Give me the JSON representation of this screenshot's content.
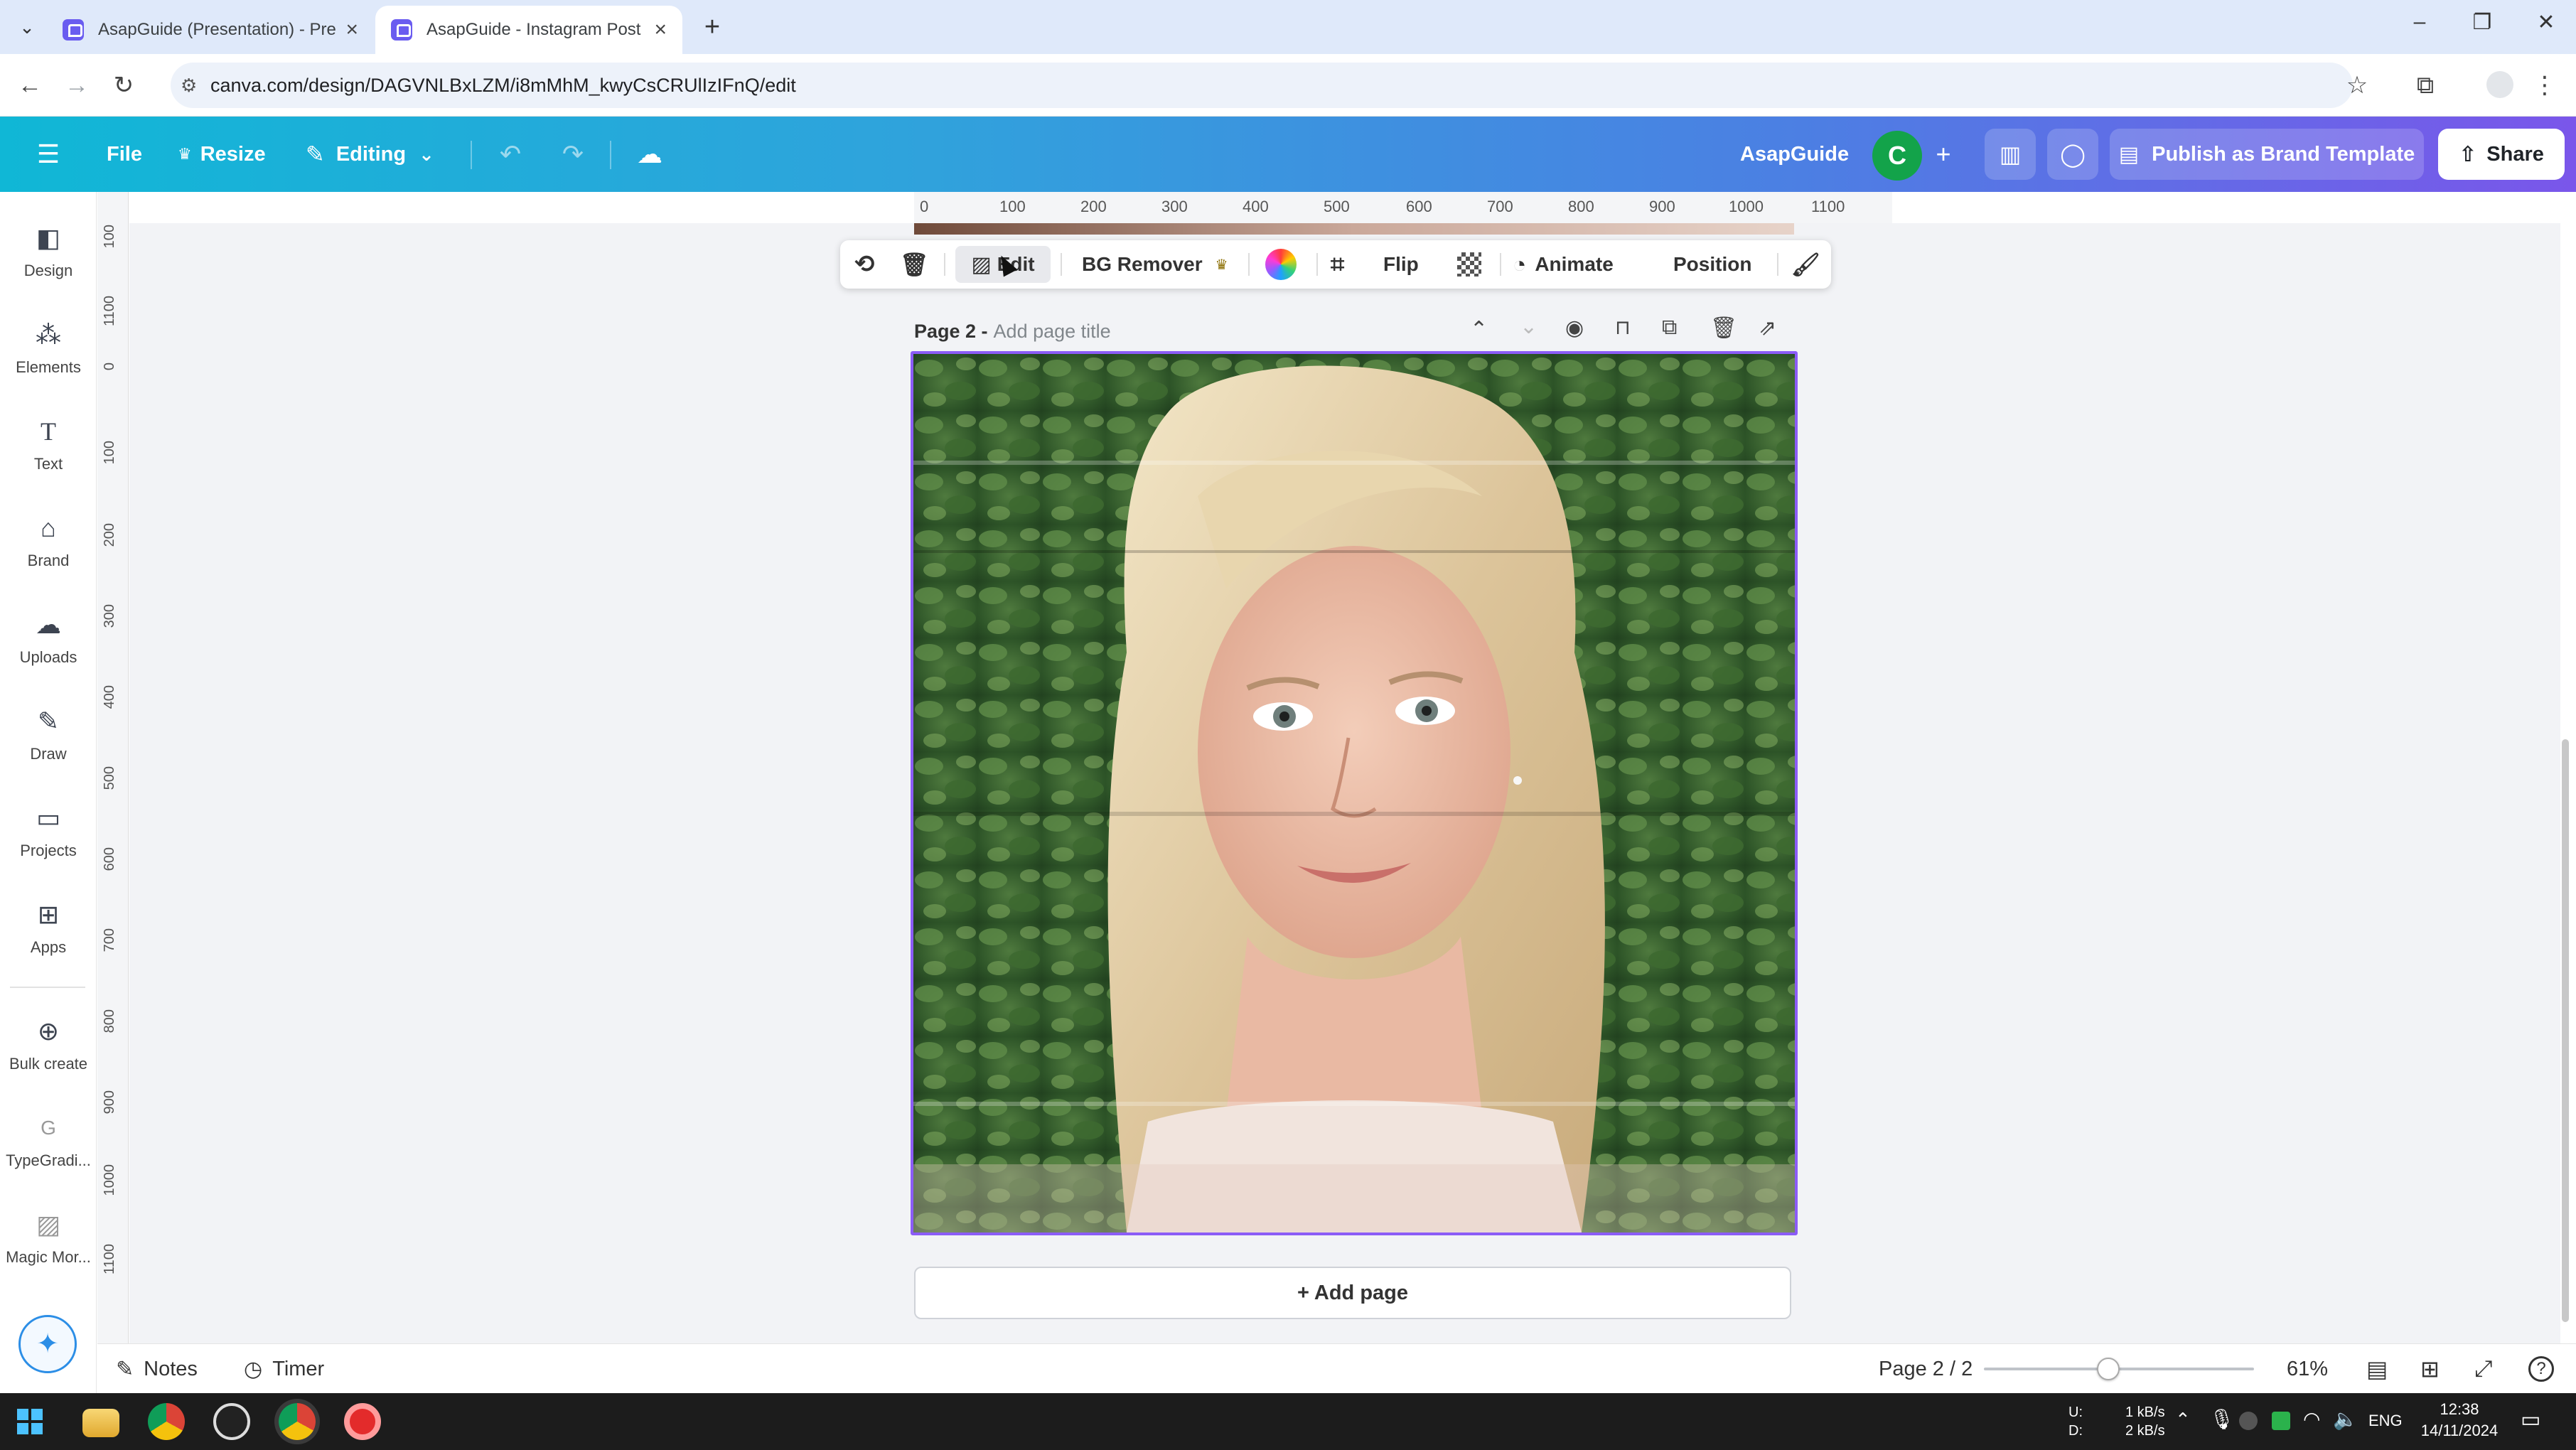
{
  "browser": {
    "tabs": [
      {
        "title": "AsapGuide (Presentation) - Pre",
        "active": false
      },
      {
        "title": "AsapGuide - Instagram Post",
        "active": true
      }
    ],
    "url": "canva.com/design/DAGVNLBxLZM/i8mMhM_kwyCsCRUlIzIFnQ/edit"
  },
  "header": {
    "file_label": "File",
    "resize_label": "Resize",
    "editing_label": "Editing",
    "workspace_name": "AsapGuide",
    "avatar_initial": "C",
    "publish_label": "Publish as Brand Template",
    "share_label": "Share"
  },
  "sidebar": {
    "items": [
      {
        "label": "Design",
        "icon": "layout-icon"
      },
      {
        "label": "Elements",
        "icon": "elements-icon"
      },
      {
        "label": "Text",
        "icon": "text-icon"
      },
      {
        "label": "Brand",
        "icon": "brand-icon"
      },
      {
        "label": "Uploads",
        "icon": "cloud-upload-icon"
      },
      {
        "label": "Draw",
        "icon": "pen-icon"
      },
      {
        "label": "Projects",
        "icon": "folder-icon"
      },
      {
        "label": "Apps",
        "icon": "apps-icon"
      },
      {
        "label": "Bulk create",
        "icon": "bulk-create-icon"
      },
      {
        "label": "TypeGradi...",
        "icon": "typegradient-icon"
      },
      {
        "label": "Magic Mor...",
        "icon": "magic-morph-icon"
      }
    ]
  },
  "rulers": {
    "horizontal": [
      "0",
      "100",
      "200",
      "300",
      "400",
      "500",
      "600",
      "700",
      "800",
      "900",
      "1000",
      "1100"
    ],
    "vertical": [
      "100",
      "1100",
      "0",
      "100",
      "200",
      "300",
      "400",
      "500",
      "600",
      "700",
      "800",
      "900",
      "1000",
      "1100"
    ]
  },
  "context_toolbar": {
    "edit_label": "Edit",
    "bg_remover_label": "BG Remover",
    "flip_label": "Flip",
    "animate_label": "Animate",
    "position_label": "Position"
  },
  "page": {
    "page_label": "Page 2 -",
    "title_placeholder": "Add page title",
    "add_page_label": "+ Add page"
  },
  "footer": {
    "notes_label": "Notes",
    "timer_label": "Timer",
    "page_indicator": "Page 2 / 2",
    "zoom_value": "61%",
    "zoom_fraction": 0.46
  },
  "taskbar": {
    "net_up_label": "U:",
    "net_down_label": "D:",
    "net_up_rate": "1 kB/s",
    "net_down_rate": "2 kB/s",
    "language": "ENG",
    "time": "12:38",
    "date": "14/11/2024"
  },
  "colors": {
    "header_gradient_start": "#10b7d6",
    "header_gradient_end": "#7a56ea",
    "selection_border": "#8b5cf6",
    "avatar_bg": "#13a34a"
  }
}
